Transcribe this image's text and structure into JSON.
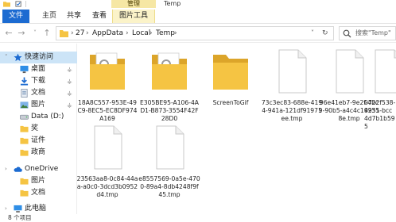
{
  "window": {
    "title": "Temp"
  },
  "ribbon": {
    "contextual_tab": "管理",
    "tabs": [
      {
        "label": "文件"
      },
      {
        "label": "主页"
      },
      {
        "label": "共享"
      },
      {
        "label": "查看"
      },
      {
        "label": "图片工具"
      }
    ]
  },
  "address": {
    "crumbs": [
      "27",
      "AppData",
      "Local",
      "Temp"
    ],
    "search_placeholder": "搜索\"Temp\""
  },
  "nav": {
    "quick_access": "快速访问",
    "items": [
      {
        "label": "桌面",
        "icon": "desktop-icon",
        "pinned": true
      },
      {
        "label": "下载",
        "icon": "download-icon",
        "pinned": true
      },
      {
        "label": "文档",
        "icon": "document-icon",
        "pinned": true
      },
      {
        "label": "图片",
        "icon": "picture-icon",
        "pinned": true
      },
      {
        "label": "Data (D:)",
        "icon": "drive-icon",
        "pinned": false
      },
      {
        "label": "奖",
        "icon": "folder-icon",
        "pinned": false
      },
      {
        "label": "证件",
        "icon": "folder-icon",
        "pinned": false
      },
      {
        "label": "政商",
        "icon": "folder-icon",
        "pinned": false
      }
    ],
    "onedrive": "OneDrive",
    "onedrive_items": [
      {
        "label": "图片",
        "icon": "folder-icon"
      },
      {
        "label": "文档",
        "icon": "folder-icon"
      }
    ],
    "this_pc": "此电脑"
  },
  "files": [
    {
      "name": "18A8C557-953E-49C9-8EC5-EC8DF974A169",
      "type": "folder-gear"
    },
    {
      "name": "E305BE95-A106-4AD1-B873-3554F42F28D0",
      "type": "folder-gear"
    },
    {
      "name": "ScreenToGif",
      "type": "folder"
    },
    {
      "name": "73c3ec83-688e-4194-941a-121df91971ee.tmp",
      "type": "file"
    },
    {
      "name": "96e41eb7-9e2f-4bc9-90b5-a4c4c192358e.tmp",
      "type": "file"
    },
    {
      "name": "0722f538-4951-bcc4d7b1b595",
      "type": "file"
    },
    {
      "name": "23563aa8-0c84-44aa-a0c0-3dcd3b0952d4.tmp",
      "type": "file"
    },
    {
      "name": "e8557569-0a5e-4700-89a4-8db4248f9f45.tmp",
      "type": "file"
    }
  ],
  "status": {
    "item_count": "8 个项目"
  },
  "colors": {
    "accent": "#1c6bd1",
    "folder": "#f5c443",
    "folder_dark": "#dca52a",
    "selection": "#cce4f7",
    "manage_tab": "#f6e7a4"
  }
}
